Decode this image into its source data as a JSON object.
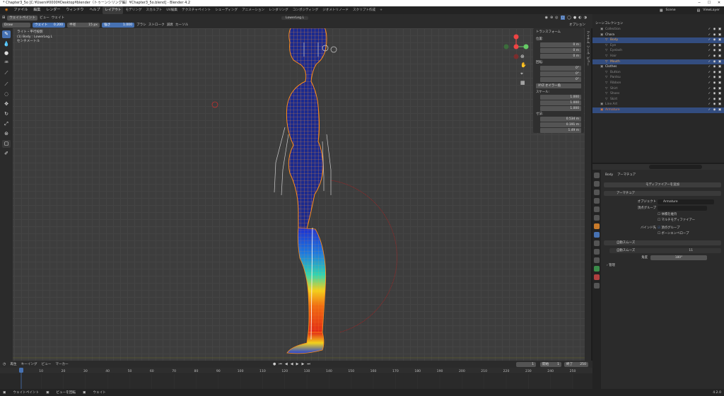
{
  "window": {
    "title": "* Chapter3_5o [C:¥Users¥0000¥Desktop¥blender（トゥーンシリング編）¥Chapter3_5o.blend] - Blender 4.2"
  },
  "menu": {
    "items": [
      "ファイル",
      "編集",
      "レンダー",
      "ウィンドウ",
      "ヘルプ"
    ]
  },
  "workspaces": {
    "tabs": [
      "レイアウト",
      "モデリング",
      "スカルプト",
      "UV編集",
      "テクスチャペイント",
      "シェーディング",
      "アニメーション",
      "レンダリング",
      "コンポジティング",
      "ジオメトリノード",
      "スクリプト作成"
    ],
    "active": "レイアウト",
    "add": "+"
  },
  "scene": {
    "label": "Scene",
    "view_layer": "ViewLayer"
  },
  "viewport_header": {
    "mode": "ウェイトペイント",
    "view": "ビュー",
    "weights": "ウェイト",
    "object_name": "LowerLeg.L",
    "options": "オプション"
  },
  "tool_header": {
    "brush": "Draw",
    "weight_label": "ウェイト",
    "weight_value": "0.200",
    "radius_label": "半径",
    "radius_value": "15 px",
    "strength_label": "強さ",
    "strength_value": "1.000",
    "brush_menu": "ブラシ",
    "stroke_menu": "ストローク",
    "falloff_menu": "減衰",
    "cursor_menu": "カーソル"
  },
  "viewport_overlay": {
    "line1": "ライト・平行投影",
    "line2": "(1) Body : LowerLeg.L",
    "line3": "センチメートル"
  },
  "npanel": {
    "header": "トランスフォーム",
    "location_label": "位置:",
    "location": [
      {
        "axis": "X",
        "value": "0 m"
      },
      {
        "axis": "Y",
        "value": "0 m"
      },
      {
        "axis": "Z",
        "value": "0 m"
      }
    ],
    "rotation_label": "回転:",
    "rotation": [
      {
        "axis": "X",
        "value": "0°"
      },
      {
        "axis": "Y",
        "value": "0°"
      },
      {
        "axis": "Z",
        "value": "0°"
      }
    ],
    "rotation_mode": "XYZ オイラー角",
    "scale_label": "スケール:",
    "scale": [
      {
        "axis": "X",
        "value": "1.000"
      },
      {
        "axis": "Y",
        "value": "1.000"
      },
      {
        "axis": "Z",
        "value": "1.000"
      }
    ],
    "dimensions_label": "寸法:",
    "dimensions": [
      {
        "axis": "X",
        "value": "0.534 m"
      },
      {
        "axis": "Y",
        "value": "0.191 m"
      },
      {
        "axis": "Z",
        "value": "1.49 m"
      }
    ],
    "side_tabs": [
      "アイテム",
      "ツール",
      "ビュー"
    ]
  },
  "outliner": {
    "header": "シーンコレクション",
    "rows": [
      {
        "name": "Collection",
        "indent": 1,
        "dim": true
      },
      {
        "name": "Chara",
        "indent": 1
      },
      {
        "name": "Body",
        "indent": 2,
        "selected": true,
        "highlight": "#e8a24a"
      },
      {
        "name": "Eye",
        "indent": 2,
        "dim": true
      },
      {
        "name": "Eyelash",
        "indent": 2,
        "dim": true
      },
      {
        "name": "Hair",
        "indent": 2,
        "dim": true
      },
      {
        "name": "Mouth",
        "indent": 2,
        "selected": true,
        "highlight": "#e8a24a"
      },
      {
        "name": "Clothes",
        "indent": 1
      },
      {
        "name": "Button",
        "indent": 2,
        "dim": true
      },
      {
        "name": "Pantsu",
        "indent": 2,
        "dim": true
      },
      {
        "name": "Ribbon",
        "indent": 2,
        "dim": true
      },
      {
        "name": "Shirt",
        "indent": 2,
        "dim": true
      },
      {
        "name": "Shoes",
        "indent": 2,
        "dim": true
      },
      {
        "name": "Skirt",
        "indent": 2,
        "dim": true
      },
      {
        "name": "Line Art",
        "indent": 1,
        "dim": true
      },
      {
        "name": "Armature",
        "indent": 1,
        "selected": true,
        "highlight": "#e07a3a"
      }
    ]
  },
  "properties": {
    "breadcrumb_obj": "Body",
    "breadcrumb_mod": "アーマチュア",
    "add_modifier": "モディファイアーを追加",
    "armature_panel": {
      "title": "アーマチュア",
      "object_label": "オブジェクト",
      "object_value": "Armature",
      "vgroup_label": "頂点グループ",
      "preserve_volume": "体積を維持",
      "multi_modifier": "マルチモディファイアー",
      "bind_label": "バインド先",
      "bind_vgroup": "頂点グループ",
      "bind_envelope": "ボーンエンベロープ"
    },
    "smooth_panel": {
      "title": "自動スムーズ",
      "node_label": "自動スムーズ",
      "node_count": "11",
      "angle_label": "角度",
      "angle_value": "180°",
      "manage": "管理"
    }
  },
  "timeline": {
    "menu": [
      "再生",
      "キーイング",
      "ビュー",
      "マーカー"
    ],
    "current_frame": "1",
    "start_label": "開始",
    "start": "1",
    "end_label": "終了",
    "end": "250",
    "ticks": [
      "1",
      "10",
      "20",
      "30",
      "40",
      "50",
      "60",
      "70",
      "80",
      "90",
      "100",
      "110",
      "120",
      "130",
      "140",
      "150",
      "160",
      "170",
      "180",
      "190",
      "200",
      "210",
      "220",
      "230",
      "240",
      "250"
    ]
  },
  "status": {
    "left": "ウェイトペイント",
    "mid": "ビューを回転",
    "right": "ウェイト",
    "version": "4.2.0"
  },
  "colors": {
    "accent": "#4772b3",
    "object_outline": "#e8872b",
    "weight_red": "#e22a16",
    "weight_blue": "#1d3fd8"
  }
}
